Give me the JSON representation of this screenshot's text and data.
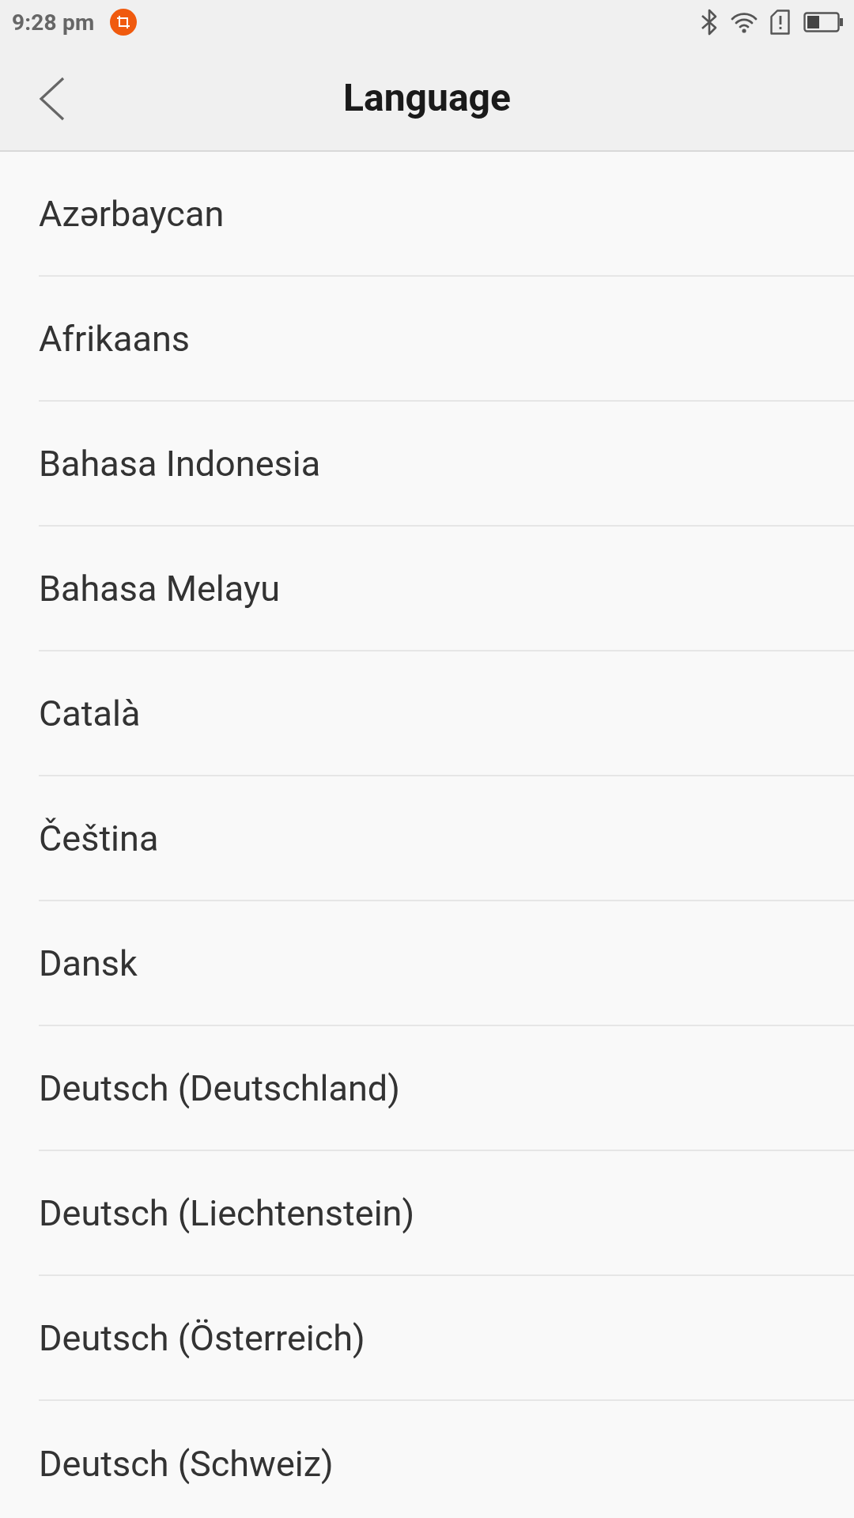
{
  "status_bar": {
    "time": "9:28 pm"
  },
  "header": {
    "title": "Language"
  },
  "languages": [
    {
      "label": "Azərbaycan"
    },
    {
      "label": "Afrikaans"
    },
    {
      "label": "Bahasa Indonesia"
    },
    {
      "label": "Bahasa Melayu"
    },
    {
      "label": "Català"
    },
    {
      "label": "Čeština"
    },
    {
      "label": "Dansk"
    },
    {
      "label": "Deutsch (Deutschland)"
    },
    {
      "label": "Deutsch (Liechtenstein)"
    },
    {
      "label": "Deutsch (Österreich)"
    },
    {
      "label": "Deutsch (Schweiz)"
    }
  ]
}
